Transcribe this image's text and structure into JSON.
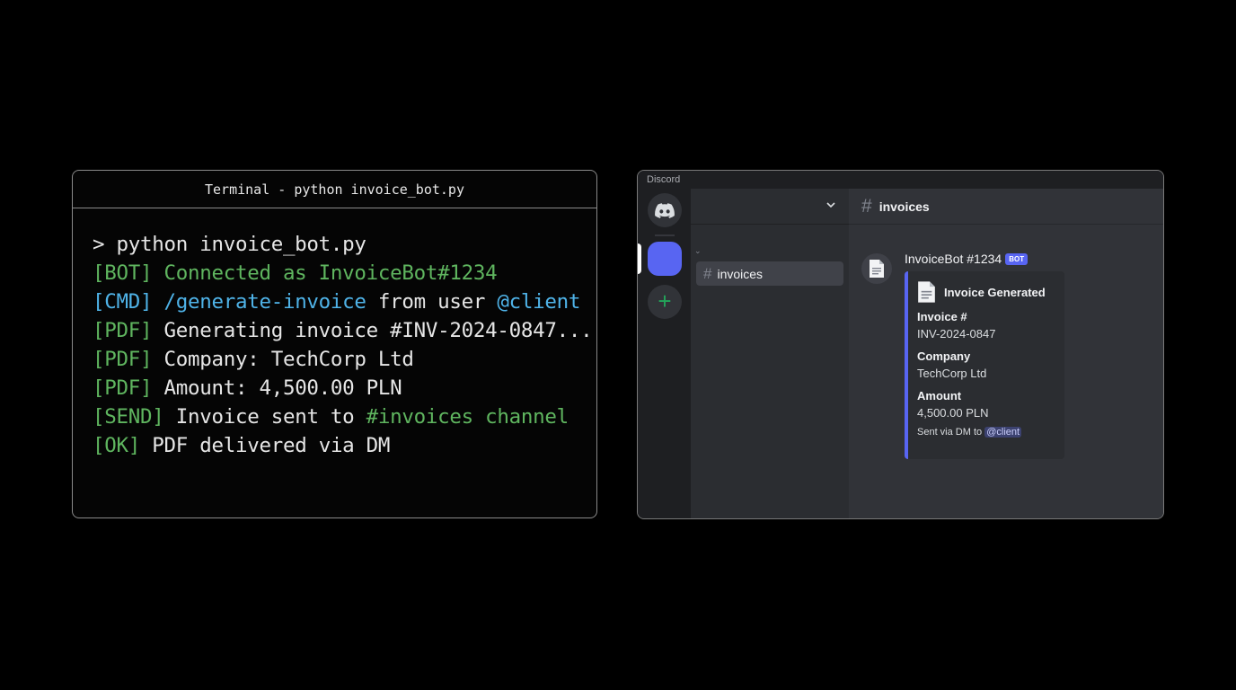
{
  "terminal": {
    "title": "Terminal - python invoice_bot.py",
    "lines": [
      [
        {
          "t": "> python invoice_bot.py",
          "c": "white"
        }
      ],
      [
        {
          "t": "[BOT] Connected as InvoiceBot#1234",
          "c": "green"
        }
      ],
      [
        {
          "t": "[CMD]",
          "c": "blue"
        },
        {
          "t": " /generate-invoice",
          "c": "blue"
        },
        {
          "t": " from user ",
          "c": "white"
        },
        {
          "t": "@client",
          "c": "blue"
        }
      ],
      [
        {
          "t": "[PDF]",
          "c": "green"
        },
        {
          "t": " Generating invoice #INV-2024-0847...",
          "c": "white"
        }
      ],
      [
        {
          "t": "[PDF]",
          "c": "green"
        },
        {
          "t": " Company: TechCorp Ltd",
          "c": "white"
        }
      ],
      [
        {
          "t": "[PDF]",
          "c": "green"
        },
        {
          "t": " Amount: 4,500.00 PLN",
          "c": "white"
        }
      ],
      [
        {
          "t": "[SEND]",
          "c": "green"
        },
        {
          "t": " Invoice sent to ",
          "c": "white"
        },
        {
          "t": "#invoices channel",
          "c": "green"
        }
      ],
      [
        {
          "t": "[OK]",
          "c": "green"
        },
        {
          "t": " PDF delivered via DM",
          "c": "white"
        }
      ]
    ]
  },
  "discord": {
    "window_title": "Discord",
    "channel_list": {
      "category_chevron": "⌄",
      "channels": [
        {
          "name": "invoices",
          "active": true
        }
      ]
    },
    "header": {
      "channel_hash": "#",
      "channel_name": "invoices"
    },
    "message": {
      "author": "InvoiceBot #1234",
      "badge": "BOT",
      "embed": {
        "title": "Invoice Generated",
        "fields": [
          {
            "name": "Invoice #",
            "value": "INV-2024-0847"
          },
          {
            "name": "Company",
            "value": "TechCorp Ltd"
          },
          {
            "name": "Amount",
            "value": "4,500.00 PLN"
          }
        ],
        "footer_text": "Sent via DM to",
        "footer_mention": "@client"
      }
    },
    "add_server_label": "+"
  },
  "colors": {
    "green": "#5fb55f",
    "blue": "#4fb3e8",
    "blurple": "#5865f2",
    "add_green": "#23a55a"
  },
  "icons": [
    "discord-logo-icon",
    "plus-icon",
    "chevron-down-icon",
    "hash-icon",
    "document-icon"
  ]
}
